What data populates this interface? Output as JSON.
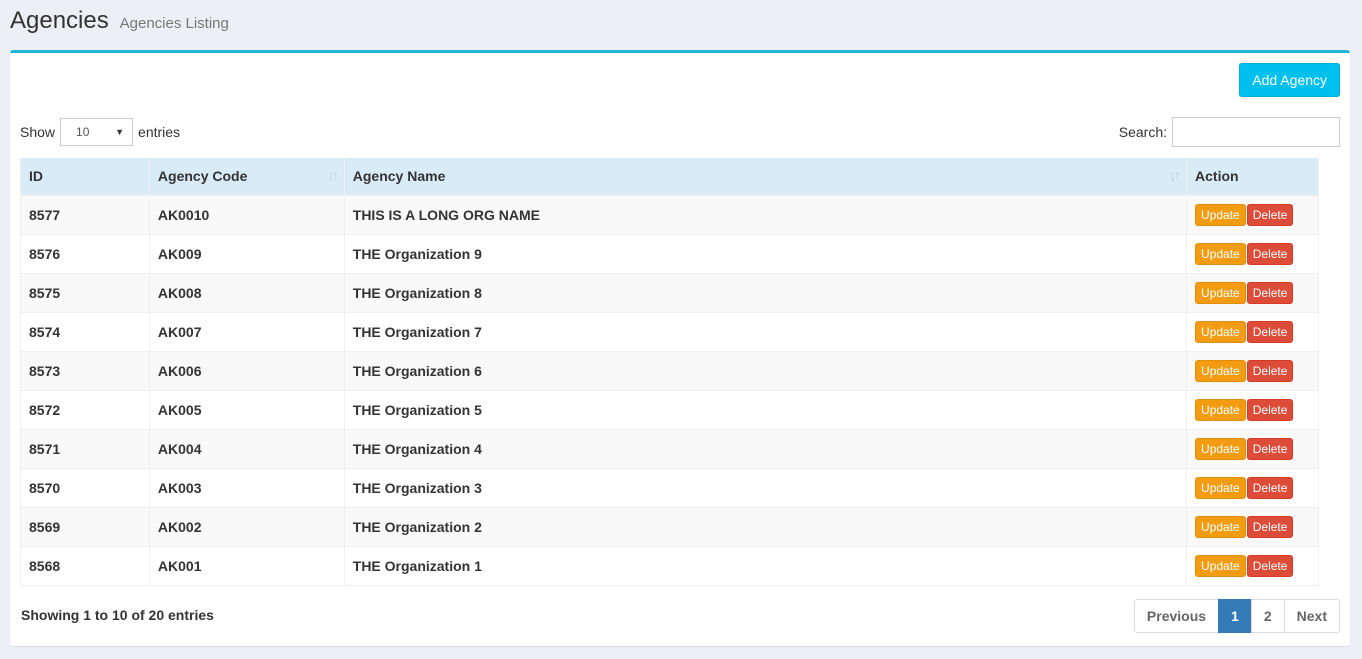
{
  "header": {
    "title": "Agencies",
    "subtitle": "Agencies Listing"
  },
  "toolbar": {
    "add_label": "Add Agency"
  },
  "length": {
    "show_label": "Show",
    "value": "10",
    "entries_label": "entries"
  },
  "search": {
    "label": "Search:",
    "value": "",
    "placeholder": ""
  },
  "colors": {
    "accent": "#1fb5d9",
    "add_button": "#00c0ef",
    "update": "#f39c12",
    "delete": "#dd4b39",
    "active_page": "#337ab7",
    "table_header": "#d9ebf7"
  },
  "table": {
    "columns": [
      {
        "label": "ID",
        "sortable": false
      },
      {
        "label": "Agency Code",
        "sortable": true,
        "sort_icon": "sort-icon"
      },
      {
        "label": "Agency Name",
        "sortable": true,
        "sort_icon": "sort-icon"
      },
      {
        "label": "Action",
        "sortable": false
      }
    ],
    "update_label": "Update",
    "delete_label": "Delete",
    "rows": [
      {
        "id": "8577",
        "code": "AK0010",
        "name": "THIS IS A LONG ORG NAME"
      },
      {
        "id": "8576",
        "code": "AK009",
        "name": "THE Organization 9"
      },
      {
        "id": "8575",
        "code": "AK008",
        "name": "THE Organization 8"
      },
      {
        "id": "8574",
        "code": "AK007",
        "name": "THE Organization 7"
      },
      {
        "id": "8573",
        "code": "AK006",
        "name": "THE Organization 6"
      },
      {
        "id": "8572",
        "code": "AK005",
        "name": "THE Organization 5"
      },
      {
        "id": "8571",
        "code": "AK004",
        "name": "THE Organization 4"
      },
      {
        "id": "8570",
        "code": "AK003",
        "name": "THE Organization 3"
      },
      {
        "id": "8569",
        "code": "AK002",
        "name": "THE Organization 2"
      },
      {
        "id": "8568",
        "code": "AK001",
        "name": "THE Organization 1"
      }
    ]
  },
  "footer": {
    "info": "Showing 1 to 10 of 20 entries",
    "pagination": {
      "previous": "Previous",
      "pages": [
        "1",
        "2"
      ],
      "active": "1",
      "next": "Next"
    }
  }
}
